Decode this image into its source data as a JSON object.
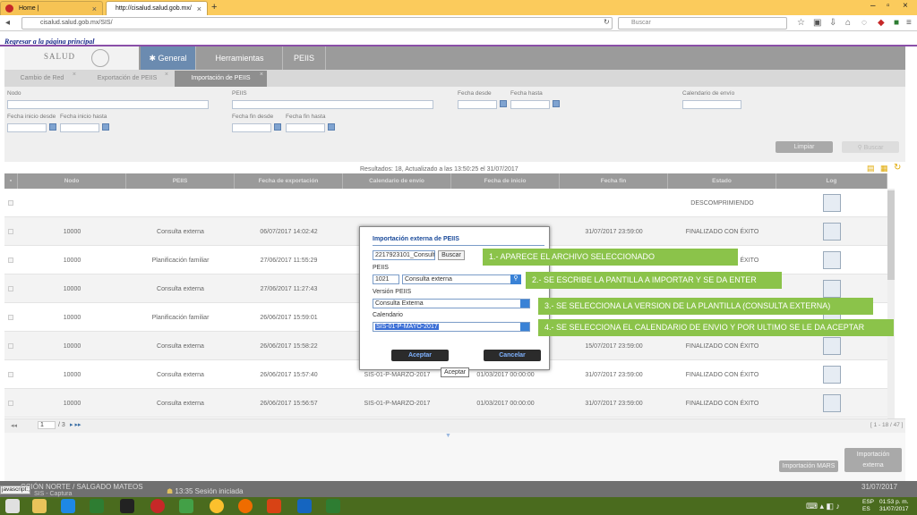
{
  "browser": {
    "tabs": [
      {
        "title": "Home |"
      },
      {
        "title": "http://cisalud.salud.gob.mx/"
      }
    ],
    "url": "cisalud.salud.gob.mx/SIS/",
    "search_placeholder": "Buscar"
  },
  "page": {
    "back_link": "Regresar a la página principal",
    "logo_text": "SALUD",
    "menu": [
      "General",
      "Herramientas",
      "PEIIS"
    ],
    "subtabs": [
      "Cambio de Red",
      "Exportación de PEIIS",
      "Importación de PEIIS"
    ]
  },
  "filters": {
    "nodo": "Nodo",
    "peiis": "PEIIS",
    "fecha_desde": "Fecha desde",
    "fecha_hasta": "Fecha hasta",
    "calendario_envio": "Calendario de envío",
    "fecha_inicio_desde": "Fecha inicio desde",
    "fecha_inicio_hasta": "Fecha inicio hasta",
    "fecha_fin_desde": "Fecha fin desde",
    "fecha_fin_hasta": "Fecha fin hasta",
    "limpiar": "Limpiar",
    "buscar": "Buscar"
  },
  "results_text": "Resultados: 18, Actualizado a las 13:50:25 el 31/07/2017",
  "table": {
    "columns": [
      "Nodo",
      "PEIIS",
      "Fecha de exportación",
      "Calendario de envío",
      "Fecha de inicio",
      "Fecha fin",
      "Estado",
      "Log"
    ],
    "rows": [
      {
        "nodo": "",
        "peiis": "",
        "fexp": "",
        "cal": "",
        "fini": "",
        "ffin": "",
        "estado": "DESCOMPRIMIENDO"
      },
      {
        "nodo": "10000",
        "peiis": "Consulta externa",
        "fexp": "06/07/2017 14:02:42",
        "cal": "",
        "fini": "",
        "ffin": "31/07/2017 23:59:00",
        "estado": "FINALIZADO CON ÉXITO"
      },
      {
        "nodo": "10000",
        "peiis": "Planificación familiar",
        "fexp": "27/06/2017 11:55:29",
        "cal": "",
        "fini": "",
        "ffin": "",
        "estado": "FINALIZADO CON ÉXITO"
      },
      {
        "nodo": "10000",
        "peiis": "Consulta externa",
        "fexp": "27/06/2017 11:27:43",
        "cal": "",
        "fini": "",
        "ffin": "",
        "estado": ""
      },
      {
        "nodo": "10000",
        "peiis": "Planificación familiar",
        "fexp": "26/06/2017 15:59:01",
        "cal": "",
        "fini": "",
        "ffin": "",
        "estado": ""
      },
      {
        "nodo": "10000",
        "peiis": "Consulta externa",
        "fexp": "26/06/2017 15:58:22",
        "cal": "",
        "fini": "",
        "ffin": "15/07/2017 23:59:00",
        "estado": "FINALIZADO CON ÉXITO"
      },
      {
        "nodo": "10000",
        "peiis": "Consulta externa",
        "fexp": "26/06/2017 15:57:40",
        "cal": "SIS-01-P-MARZO-2017",
        "fini": "01/03/2017 00:00:00",
        "ffin": "31/07/2017 23:59:00",
        "estado": "FINALIZADO CON ÉXITO"
      },
      {
        "nodo": "10000",
        "peiis": "Consulta externa",
        "fexp": "26/06/2017 15:56:57",
        "cal": "SIS-01-P-MARZO-2017",
        "fini": "01/03/2017 00:00:00",
        "ffin": "31/07/2017 23:59:00",
        "estado": "FINALIZADO CON ÉXITO"
      }
    ]
  },
  "pager": {
    "page": "1",
    "of": "/ 3",
    "range": "[ 1 - 18 / 47 ]"
  },
  "footer_buttons": {
    "mars": "Importación MARS",
    "externa_1": "Importación",
    "externa_2": "externa"
  },
  "dialog": {
    "title": "Importación externa de PEIIS",
    "file_value": "2217923101_Consulta",
    "buscar": "Buscar",
    "peiis_label": "PEIIS",
    "peiis_code": "1021",
    "peiis_name": "Consulta externa",
    "version_label": "Versión PEIIS",
    "version_value": "Consulta Externa",
    "calendario_label": "Calendario",
    "calendario_value": "SIS-01-P-MAYO-2017",
    "aceptar": "Aceptar",
    "cancelar": "Cancelar",
    "tooltip": "Aceptar"
  },
  "notes": [
    "1.- APARECE EL ARCHIVO SELECCIONADO",
    "2.- SE ESCRIBE LA PANTILLA A IMPORTAR Y SE DA ENTER",
    "3.- SE SELECCIONA LA VERSION DE LA PLANTILLA (CONSULTA EXTERNA)",
    "4.- SE SELECCIONA EL CALENDARIO DE ENVIO Y POR ULTIMO SE LE DA ACEPTAR"
  ],
  "status": {
    "left": "CCIÓN NORTE / SALGADO MATEOS",
    "session": "13:35 Sesión iniciada",
    "date": "31/07/2017",
    "js": "javascript:;",
    "sub": "SIS - Captura"
  },
  "taskbar": {
    "lang1": "ESP",
    "lang2": "ES",
    "time": "01:53 p. m.",
    "date": "31/07/2017"
  }
}
